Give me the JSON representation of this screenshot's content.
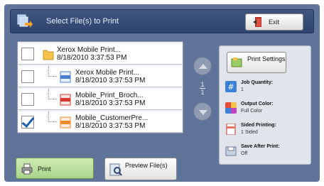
{
  "header": {
    "title": "Select File(s) to Print",
    "exit_label": "Exit"
  },
  "files": [
    {
      "name": "Xerox Mobile Print...",
      "date": "8/18/2010 3:37:53 PM",
      "checked": false,
      "icon": "folder-icon",
      "color": "#f5c34a"
    },
    {
      "name": "Xerox Mobile Print...",
      "date": "8/18/2010 3:37:53 PM",
      "checked": false,
      "icon": "doc-file-icon",
      "color": "#4a7fd0"
    },
    {
      "name": "Mobile_Print_Broch...",
      "date": "8/18/2010 3:37:53 PM",
      "checked": false,
      "icon": "pdf-file-icon",
      "color": "#d63b2f"
    },
    {
      "name": "Mobile_CustomerPre...",
      "date": "8/18/2010 3:37:53 PM",
      "checked": true,
      "icon": "ppt-file-icon",
      "color": "#f08a2a"
    }
  ],
  "pagination": {
    "current": "1",
    "total": "1"
  },
  "print_settings": {
    "button_label": "Print Settings",
    "items": [
      {
        "title": "Job Quantity:",
        "value": "1",
        "icon": "hash-icon"
      },
      {
        "title": "Output Color:",
        "value": "Full Color",
        "icon": "color-palette-icon"
      },
      {
        "title": "Sided Printing:",
        "value": "1 Sided",
        "icon": "page-sided-icon"
      },
      {
        "title": "Save After Print:",
        "value": "Off",
        "icon": "save-icon"
      }
    ]
  },
  "buttons": {
    "print": "Print",
    "preview": "Preview File(s)"
  },
  "colors": {
    "frame": "#5f7498",
    "header": "#2f4570",
    "accent_check": "#1f5fb0",
    "print_button": "#a9d48a"
  }
}
